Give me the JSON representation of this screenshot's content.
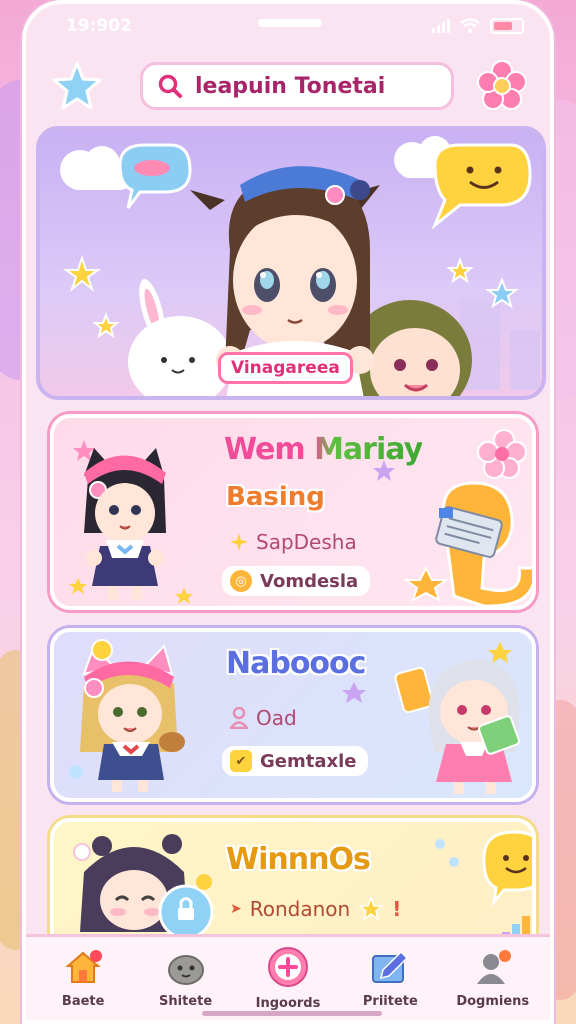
{
  "status_bar": {
    "time": "19:902"
  },
  "search": {
    "placeholder": "leapuin Tonetai"
  },
  "hero": {
    "caption": "Vinagareea"
  },
  "cards": [
    {
      "title": "Wem Mariay",
      "subtitle": "Basing",
      "meta": "SapDesha",
      "pill": "Vomdesla",
      "colors": {
        "title_left": "#f04c9a",
        "title_right": "#5dbf3f",
        "accent": "#f07c2e"
      }
    },
    {
      "title": "Naboooc",
      "meta": "Oad",
      "pill": "Gemtaxle",
      "colors": {
        "title": "#5b6fe0",
        "accent": "#e78db0"
      }
    },
    {
      "title": "WinnnOs",
      "meta": "Rondanon",
      "colors": {
        "title": "#e69a12",
        "accent": "#e05b42"
      }
    }
  ],
  "tabs": [
    {
      "label": "Baete",
      "icon": "house-icon"
    },
    {
      "label": "Shitete",
      "icon": "rock-icon"
    },
    {
      "label": "Ingoords",
      "icon": "plus-circle-icon"
    },
    {
      "label": "Priitete",
      "icon": "edit-icon"
    },
    {
      "label": "Dogmiens",
      "icon": "profile-icon"
    }
  ]
}
